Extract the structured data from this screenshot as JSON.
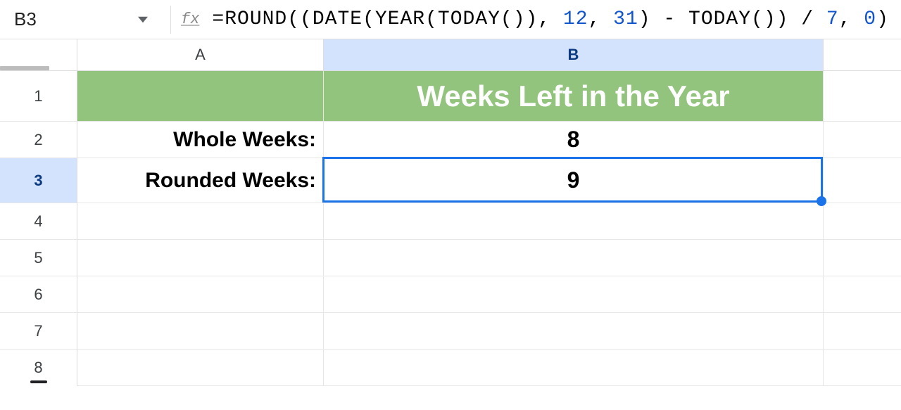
{
  "namebox": {
    "current_cell": "B3"
  },
  "formula_bar": {
    "fx_label": "fx",
    "tokens": [
      {
        "t": "=",
        "c": "punc"
      },
      {
        "t": "ROUND",
        "c": "fn"
      },
      {
        "t": "((",
        "c": "punc"
      },
      {
        "t": "DATE",
        "c": "fn"
      },
      {
        "t": "(",
        "c": "punc"
      },
      {
        "t": "YEAR",
        "c": "fn"
      },
      {
        "t": "(",
        "c": "punc"
      },
      {
        "t": "TODAY",
        "c": "fn"
      },
      {
        "t": "())",
        "c": "punc"
      },
      {
        "t": ", ",
        "c": "punc"
      },
      {
        "t": "12",
        "c": "num"
      },
      {
        "t": ", ",
        "c": "punc"
      },
      {
        "t": "31",
        "c": "num"
      },
      {
        "t": ")",
        "c": "punc"
      },
      {
        "t": " - ",
        "c": "punc"
      },
      {
        "t": "TODAY",
        "c": "fn"
      },
      {
        "t": "())",
        "c": "punc"
      },
      {
        "t": " / ",
        "c": "slash"
      },
      {
        "t": "7",
        "c": "num"
      },
      {
        "t": ", ",
        "c": "punc"
      },
      {
        "t": "0",
        "c": "num"
      },
      {
        "t": ")",
        "c": "punc"
      }
    ]
  },
  "columns": {
    "A": "A",
    "B": "B"
  },
  "rows": {
    "r1": "1",
    "r2": "2",
    "r3": "3",
    "r4": "4",
    "r5": "5",
    "r6": "6",
    "r7": "7",
    "r8": "8"
  },
  "cells": {
    "B1": "Weeks Left in the Year",
    "A2": "Whole Weeks:",
    "B2": "8",
    "A3": "Rounded Weeks:",
    "B3": "9"
  },
  "selected_cell": "B3",
  "colors": {
    "title_bg": "#93c47d",
    "selection": "#1a73e8",
    "active_header_bg": "#d3e3fd"
  },
  "chart_data": {
    "type": "table",
    "title": "Weeks Left in the Year",
    "rows": [
      {
        "label": "Whole Weeks:",
        "value": 8
      },
      {
        "label": "Rounded Weeks:",
        "value": 9
      }
    ],
    "formula_B3": "=ROUND((DATE(YEAR(TODAY()), 12, 31) - TODAY()) / 7, 0)"
  }
}
